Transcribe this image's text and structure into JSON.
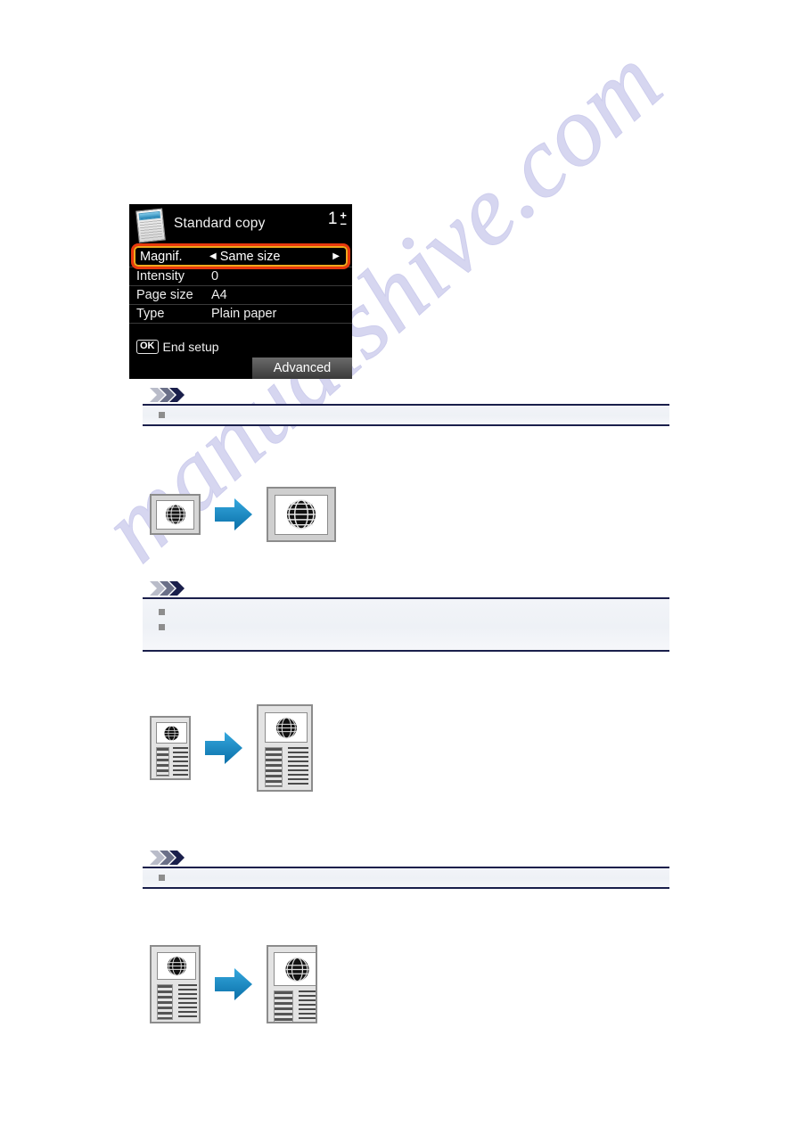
{
  "page": {
    "watermark": "manualshive.com",
    "background_color": "#ffffff"
  },
  "lcd": {
    "title": "Standard copy",
    "doc_icon": "document-icon",
    "copies": {
      "count": "1",
      "plus": "+",
      "minus": "–"
    },
    "selected_row": {
      "label": "Magnif.",
      "value": "Same size",
      "left_arrow": "◀",
      "right_arrow": "▶",
      "highlight_outer_color": "#e8380d",
      "highlight_inner_color": "#f0a81c"
    },
    "rows": [
      {
        "label": "Intensity",
        "value": "0"
      },
      {
        "label": "Page size",
        "value": "A4"
      },
      {
        "label": "Type",
        "value": "Plain paper"
      }
    ],
    "footer": {
      "ok_key": "OK",
      "ok_label": "End setup",
      "advanced_label": "Advanced"
    },
    "screen_bg": "#000000",
    "screen_text_color": "#ffffff"
  },
  "notes": [
    {
      "icon": "double-chevron-icon",
      "items": [
        {
          "bullet": "square-bullet",
          "text": ""
        }
      ]
    },
    {
      "icon": "double-chevron-icon",
      "items": [
        {
          "bullet": "square-bullet",
          "text": ""
        },
        {
          "bullet": "square-bullet",
          "text": ""
        }
      ]
    },
    {
      "icon": "double-chevron-icon",
      "items": [
        {
          "bullet": "square-bullet",
          "text": ""
        }
      ]
    }
  ],
  "figures": [
    {
      "name": "photo-enlarge-figure",
      "source": "framed-photo-small",
      "arrow": "blue-right-arrow",
      "result": "framed-photo-large"
    },
    {
      "name": "document-enlarge-figure",
      "source": "document-page-small",
      "arrow": "blue-right-arrow",
      "result": "document-page-large"
    },
    {
      "name": "document-zoom-figure",
      "source": "document-page-small",
      "arrow": "blue-right-arrow",
      "result": "document-page-zoomed"
    }
  ],
  "colors": {
    "arrow_blue_light": "#2f9fd8",
    "arrow_blue_dark": "#0a6fa8",
    "note_border": "#1a1f4b",
    "note_bg": "#eef1f6",
    "chevron_navy": "#1a1f4b",
    "chevron_gray": "#b9bcc9",
    "watermark_color": "#cfcfee"
  }
}
